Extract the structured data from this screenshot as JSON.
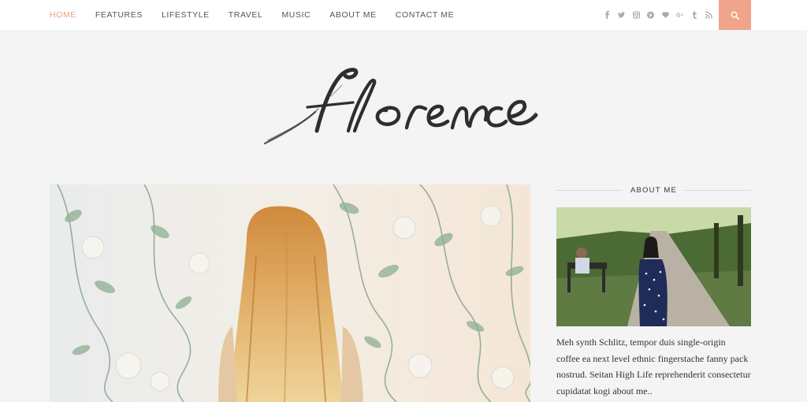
{
  "nav": {
    "items": [
      {
        "label": "HOME",
        "active": true
      },
      {
        "label": "FEATURES"
      },
      {
        "label": "LIFESTYLE"
      },
      {
        "label": "TRAVEL"
      },
      {
        "label": "MUSIC"
      },
      {
        "label": "ABOUT ME"
      },
      {
        "label": "CONTACT ME"
      }
    ],
    "social_icons": [
      "facebook-icon",
      "twitter-icon",
      "instagram-icon",
      "pinterest-icon",
      "bloglovin-heart-icon",
      "google-plus-icon",
      "tumblr-icon",
      "rss-icon"
    ],
    "search_icon": "search-icon"
  },
  "brand": {
    "logo_text": "florence"
  },
  "hero": {
    "image": "woman with long wavy blonde hair facing a floral wallpaper"
  },
  "sidebar": {
    "heading": "ABOUT ME",
    "image": "woman in polka-dot dress walking in a park path",
    "text": "Meh synth Schlitz, tempor duis single-origin coffee ea next level ethnic fingerstache fanny pack nostrud. Seitan High Life reprehenderit consectetur cupidatat kogi about me.."
  },
  "colors": {
    "accent": "#e8a382",
    "search_bg": "#f0a48b",
    "page_bg": "#f4f4f4"
  }
}
